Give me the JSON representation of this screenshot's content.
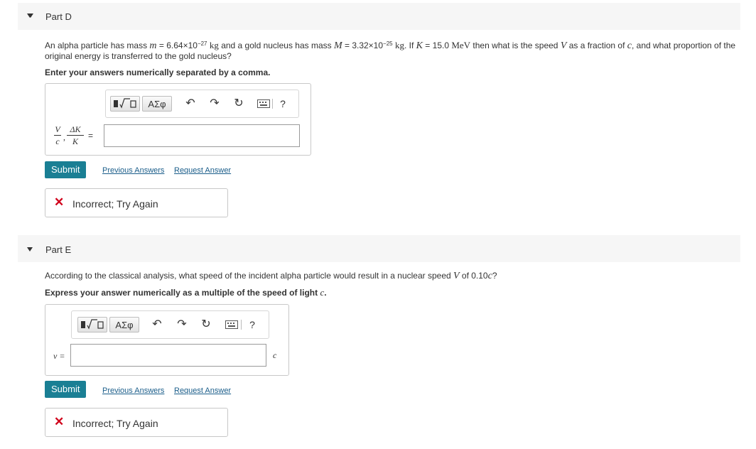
{
  "part_d": {
    "title": "Part D",
    "question_lines": {
      "l1_a": "An alpha particle has mass ",
      "m_sym": "m",
      "l1_b": " = 6.64×10",
      "m_exp": "−27",
      "kg": "kg",
      "l1_c": " and a gold nucleus has mass ",
      "M_sym": "M",
      "l1_d": " = 3.32×10",
      "M_exp": "−25",
      "kg2": "kg",
      "l1_e": ". If ",
      "K_sym": "K",
      "l1_f": " = 15.0 ",
      "mev": "MeV",
      "l1_g": " then what is the speed ",
      "V_sym": "V",
      "l1_h": " as a fraction of ",
      "c_sym": "c",
      "l1_i": ", and what proportion of the",
      "line2": "original energy is transferred to the gold nucleus?"
    },
    "instruction": "Enter your answers numerically separated by a comma.",
    "label": {
      "v_num": "V",
      "v_den": "c",
      "sep": ",",
      "k_num": "ΔK",
      "k_den": "K",
      "eq": "="
    },
    "input_value": "",
    "submit_label": "Submit",
    "previous_answers": "Previous Answers",
    "request_answer": "Request Answer",
    "feedback": "Incorrect; Try Again"
  },
  "part_e": {
    "title": "Part E",
    "question_a": "According to the classical analysis, what speed of the incident alpha particle would result in a nuclear speed ",
    "V_sym": "V",
    "question_b": " of 0.10",
    "c_sym": "c",
    "question_c": "?",
    "instruction_a": "Express your answer numerically as a multiple of the speed of light ",
    "instruction_c": "c",
    "instruction_b": ".",
    "label": "v =",
    "unit": "c",
    "input_value": "",
    "submit_label": "Submit",
    "previous_answers": "Previous Answers",
    "request_answer": "Request Answer",
    "feedback": "Incorrect; Try Again"
  },
  "toolbar": {
    "greek": "ΑΣφ",
    "help": "?"
  },
  "colors": {
    "submit": "#1a7f94",
    "link": "#1a5d8a",
    "error": "#d0021b"
  }
}
